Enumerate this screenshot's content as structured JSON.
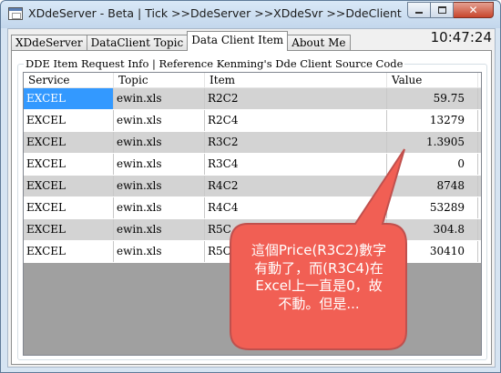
{
  "window": {
    "title": "XDdeServer - Beta | Tick >>DdeServer >>XDdeSvr >>DdeClient",
    "minimize_glyph": "",
    "maximize_glyph": "",
    "close_glyph": "✕"
  },
  "tabs": [
    {
      "label": "XDdeServer",
      "active": false
    },
    {
      "label": "DataClient Topic",
      "active": false
    },
    {
      "label": "Data Client Item",
      "active": true
    },
    {
      "label": "About Me",
      "active": false
    }
  ],
  "clock": "10:47:24",
  "group": {
    "title": "DDE Item Request Info | Reference Kenming's Dde Client Source Code"
  },
  "table": {
    "columns": [
      "Service",
      "Topic",
      "Item",
      "Value"
    ],
    "rows": [
      {
        "service": "EXCEL",
        "topic": "ewin.xls",
        "item": "R2C2",
        "value": "59.75"
      },
      {
        "service": "EXCEL",
        "topic": "ewin.xls",
        "item": "R2C4",
        "value": "13279"
      },
      {
        "service": "EXCEL",
        "topic": "ewin.xls",
        "item": "R3C2",
        "value": "1.3905"
      },
      {
        "service": "EXCEL",
        "topic": "ewin.xls",
        "item": "R3C4",
        "value": "0"
      },
      {
        "service": "EXCEL",
        "topic": "ewin.xls",
        "item": "R4C2",
        "value": "8748"
      },
      {
        "service": "EXCEL",
        "topic": "ewin.xls",
        "item": "R4C4",
        "value": "53289"
      },
      {
        "service": "EXCEL",
        "topic": "ewin.xls",
        "item": "R5C",
        "value": "304.8"
      },
      {
        "service": "EXCEL",
        "topic": "ewin.xls",
        "item": "R5C",
        "value": "30410"
      }
    ]
  },
  "annotation": {
    "lines": [
      "這個Price(R3C2)數字",
      "有動了，而(R3C4)在",
      "Excel上一直是0，故",
      "不動。但是..."
    ],
    "fill_color": "#f15f54",
    "border_color": "#c0504d"
  },
  "colors": {
    "selection": "#3399ff",
    "row_alt": "#d3d3d3",
    "empty_area": "#a0a0a0"
  }
}
